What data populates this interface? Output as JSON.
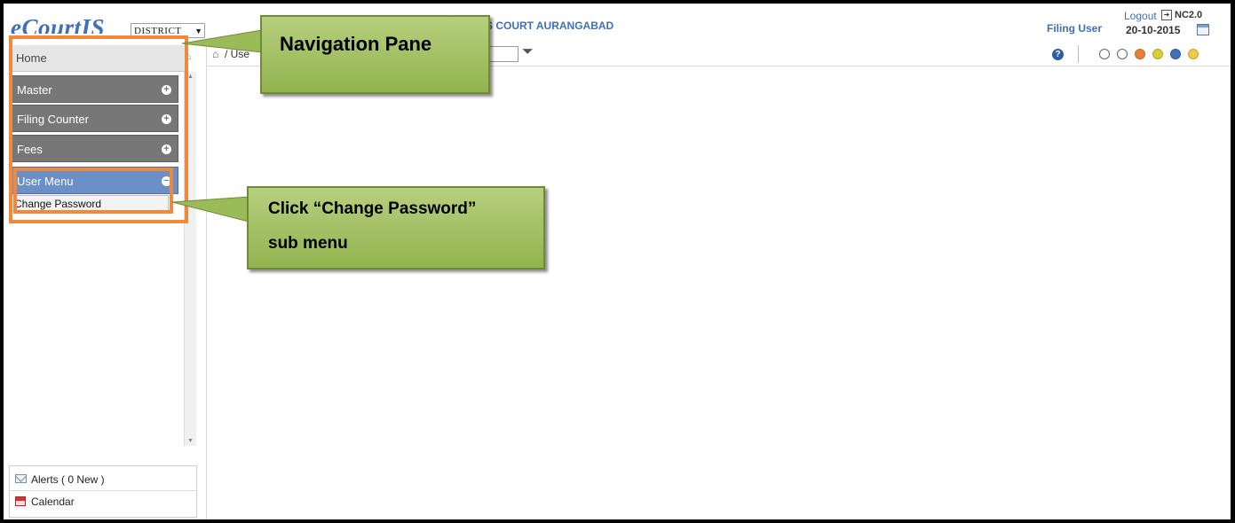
{
  "header": {
    "logo": "eCourtIS",
    "court_select": "DISTRICT",
    "court_name": "S COURT AURANGABAD",
    "user": "Filing User",
    "logout": "Logout",
    "version": "NC2.0",
    "date": "20-10-2015"
  },
  "sidebar": {
    "home": "Home",
    "items": [
      {
        "label": "Master"
      },
      {
        "label": "Filing Counter"
      },
      {
        "label": "Fees"
      },
      {
        "label": "User Menu"
      }
    ],
    "submenu": "Change Password",
    "alerts": "Alerts ( 0 New )",
    "calendar": "Calendar"
  },
  "toolbar": {
    "breadcrumb": "/ Use"
  },
  "theme_colors": [
    "#ffffff",
    "#ffffff",
    "#e8803a",
    "#d8cc3a",
    "#3f70b8",
    "#f0c84a"
  ],
  "callouts": {
    "navigation": "Navigation Pane",
    "change_line1": "Click “Change Password”",
    "change_line2": "sub menu"
  }
}
